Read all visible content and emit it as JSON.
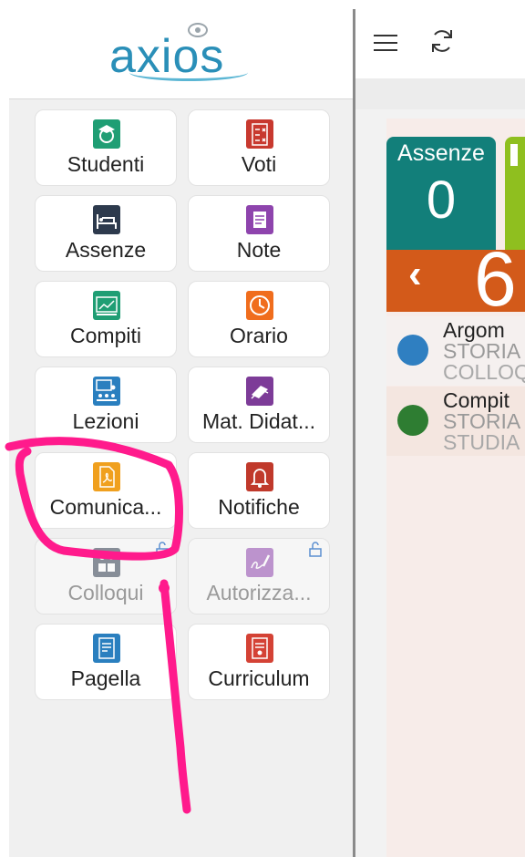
{
  "app": {
    "logo_text": "axios"
  },
  "toolbar": {
    "menu_icon": "hamburger-menu-icon",
    "refresh_icon": "refresh-icon"
  },
  "tiles": [
    {
      "label": "Studenti",
      "icon": "student-icon",
      "color": "#1f9e74",
      "locked": false
    },
    {
      "label": "Voti",
      "icon": "grades-icon",
      "color": "#c8392f",
      "locked": false
    },
    {
      "label": "Assenze",
      "icon": "bed-icon",
      "color": "#2d3a4d",
      "locked": false
    },
    {
      "label": "Note",
      "icon": "note-icon",
      "color": "#8e44ad",
      "locked": false
    },
    {
      "label": "Compiti",
      "icon": "chart-board-icon",
      "color": "#1f9e74",
      "locked": false
    },
    {
      "label": "Orario",
      "icon": "clock-icon",
      "color": "#f06d1d",
      "locked": false
    },
    {
      "label": "Lezioni",
      "icon": "classroom-icon",
      "color": "#2a7fbf",
      "locked": false
    },
    {
      "label": "Mat. Didat...",
      "icon": "books-icon",
      "color": "#7d3c98",
      "locked": false
    },
    {
      "label": "Comunica...",
      "icon": "pdf-icon",
      "color": "#f0a01e",
      "locked": false
    },
    {
      "label": "Notifiche",
      "icon": "bell-icon",
      "color": "#c0392b",
      "locked": false
    },
    {
      "label": "Colloqui",
      "icon": "meeting-icon",
      "color": "#2d3a4d",
      "locked": true
    },
    {
      "label": "Autorizza...",
      "icon": "signature-icon",
      "color": "#8e44ad",
      "locked": true
    },
    {
      "label": "Pagella",
      "icon": "report-card-icon",
      "color": "#2a7fbf",
      "locked": false
    },
    {
      "label": "Curriculum",
      "icon": "certificate-icon",
      "color": "#d44235",
      "locked": false
    }
  ],
  "summary": {
    "assenze_label": "Assenze",
    "assenze_value": "0",
    "calendar_prev": "‹",
    "calendar_day": "6"
  },
  "events": [
    {
      "title": "Argom",
      "subject": "STORIA",
      "detail": "COLLOQ",
      "color": "#2f7fc1"
    },
    {
      "title": "Compit",
      "subject": "STORIA",
      "detail": "STUDIA",
      "color": "#2e7d32"
    }
  ],
  "colors": {
    "annotation": "#ff1a8c",
    "divider": "#8a8a8a"
  }
}
